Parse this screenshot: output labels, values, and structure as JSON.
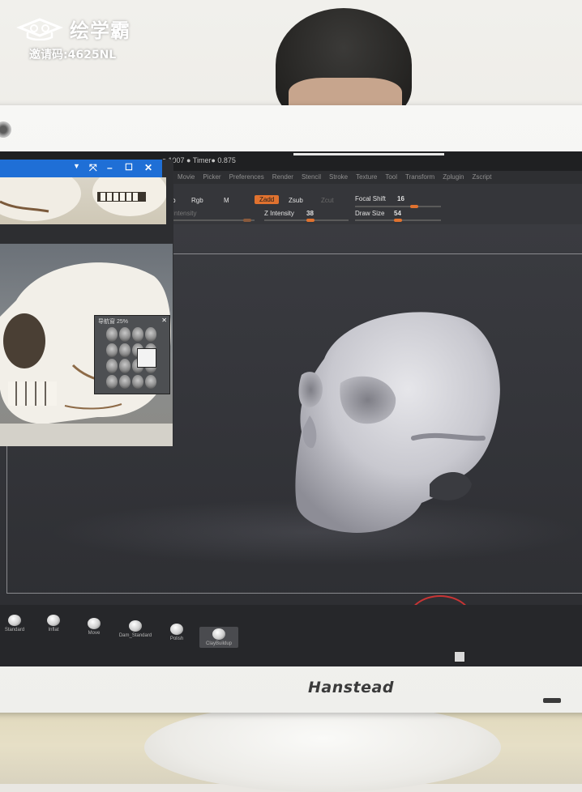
{
  "watermark": {
    "brand_name": "绘学霸",
    "invite_text": "邀请码:4625NL"
  },
  "monitor": {
    "brand": "Hanstead"
  },
  "app": {
    "title_info": "o 1007 ● Timer● 0.875",
    "menu": [
      "Movie",
      "Picker",
      "Preferences",
      "Render",
      "Stencil",
      "Stroke",
      "Texture",
      "Tool",
      "Transform",
      "Zplugin",
      "Zscript"
    ],
    "toolbar": {
      "mrgb": "rgb",
      "rgb": "Rgb",
      "m": "M",
      "zadd": "Zadd",
      "zsub": "Zsub",
      "zcut": "Zcut",
      "focal_shift_label": "Focal Shift",
      "focal_shift_value": "16",
      "z_intensity_label": "Z Intensity",
      "z_intensity_value": "38",
      "draw_size_label": "Draw Size",
      "draw_size_value": "54",
      "rgb_intensity_label": "b Intensity"
    },
    "reference_window": {
      "minimap_title": "导航窗 25%"
    },
    "brushes": [
      {
        "label": "Standard"
      },
      {
        "label": "Inflat"
      },
      {
        "label": "Move"
      },
      {
        "label": "Dam_Standard"
      },
      {
        "label": "Polish"
      },
      {
        "label": "ClayBuildup"
      }
    ]
  }
}
